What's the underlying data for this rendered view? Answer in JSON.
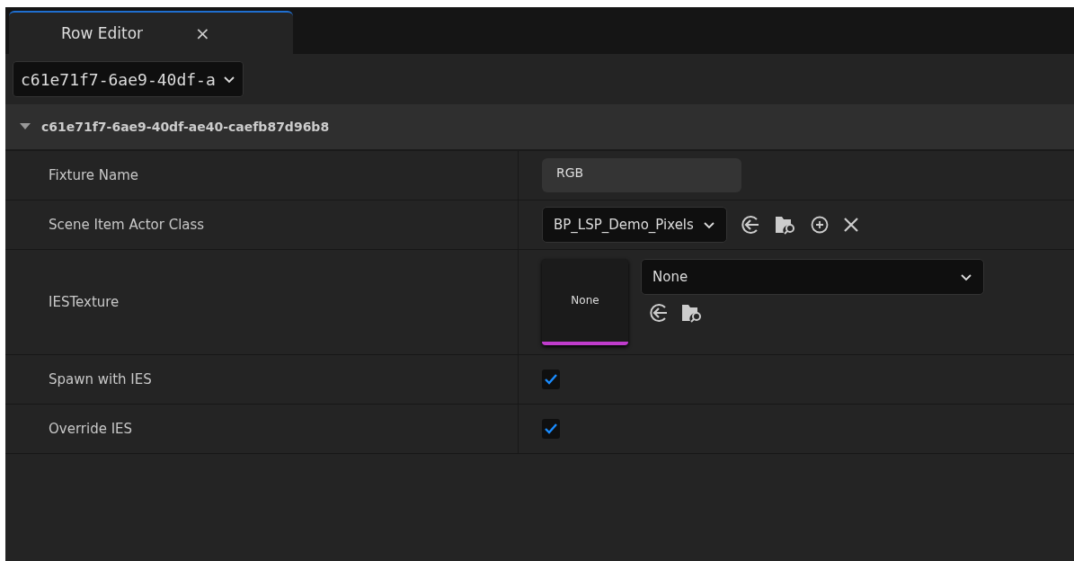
{
  "tab": {
    "label": "Row Editor",
    "close": "×",
    "selected": true
  },
  "row_picker": {
    "value": "c61e71f7-6ae9-40df-a"
  },
  "section": {
    "title": "c61e71f7-6ae9-40df-ae40-caefb87d96b8",
    "expanded": true
  },
  "properties": [
    {
      "kind": "text",
      "label": "Fixture Name",
      "value": "RGB"
    },
    {
      "kind": "class",
      "label": "Scene Item Actor Class",
      "value": "BP_LSP_Demo_Pixels"
    },
    {
      "kind": "texture",
      "label": "IESTexture",
      "thumbnail": "None",
      "value": "None"
    },
    {
      "kind": "checkbox",
      "label": "Spawn with IES",
      "checked": true
    },
    {
      "kind": "checkbox",
      "label": "Override IES",
      "checked": true
    }
  ]
}
